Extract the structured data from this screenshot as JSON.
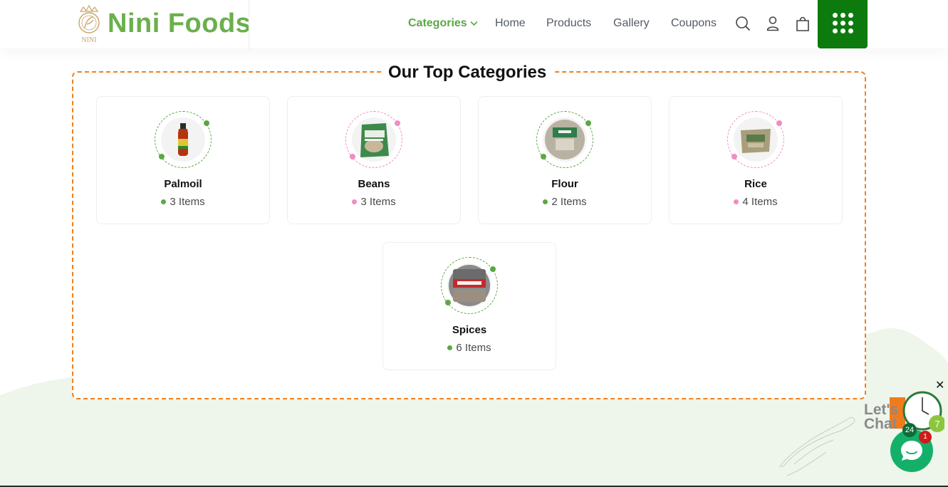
{
  "brand": {
    "name": "Nini Foods",
    "emblem_text": "NINI"
  },
  "nav": {
    "items": [
      {
        "label": "Categories",
        "active": true
      },
      {
        "label": "Home",
        "active": false
      },
      {
        "label": "Products",
        "active": false
      },
      {
        "label": "Gallery",
        "active": false
      },
      {
        "label": "Coupons",
        "active": false
      }
    ],
    "icons": [
      "search-icon",
      "user-icon",
      "shopping-bag-icon",
      "grid-menu-icon"
    ]
  },
  "section": {
    "title": "Our Top Categories"
  },
  "categories": [
    {
      "name": "Palmoil",
      "count": "3 Items",
      "accent": "green"
    },
    {
      "name": "Beans",
      "count": "3 Items",
      "accent": "pink"
    },
    {
      "name": "Flour",
      "count": "2 Items",
      "accent": "green"
    },
    {
      "name": "Rice",
      "count": "4 Items",
      "accent": "pink"
    },
    {
      "name": "Spices",
      "count": "6 Items",
      "accent": "green"
    }
  ],
  "chat": {
    "text_line1": "Let's",
    "text_line2": "Chat",
    "badge_24": "24",
    "badge_7": "7",
    "unread": "1",
    "close": "✕"
  },
  "colors": {
    "brand_green": "#6ab04c",
    "nav_active": "#5aa845",
    "menu_button": "#0c7a0c",
    "dashed_border": "#f0801f",
    "pink_accent": "#f08cc4",
    "chat_green": "#14b06a"
  }
}
